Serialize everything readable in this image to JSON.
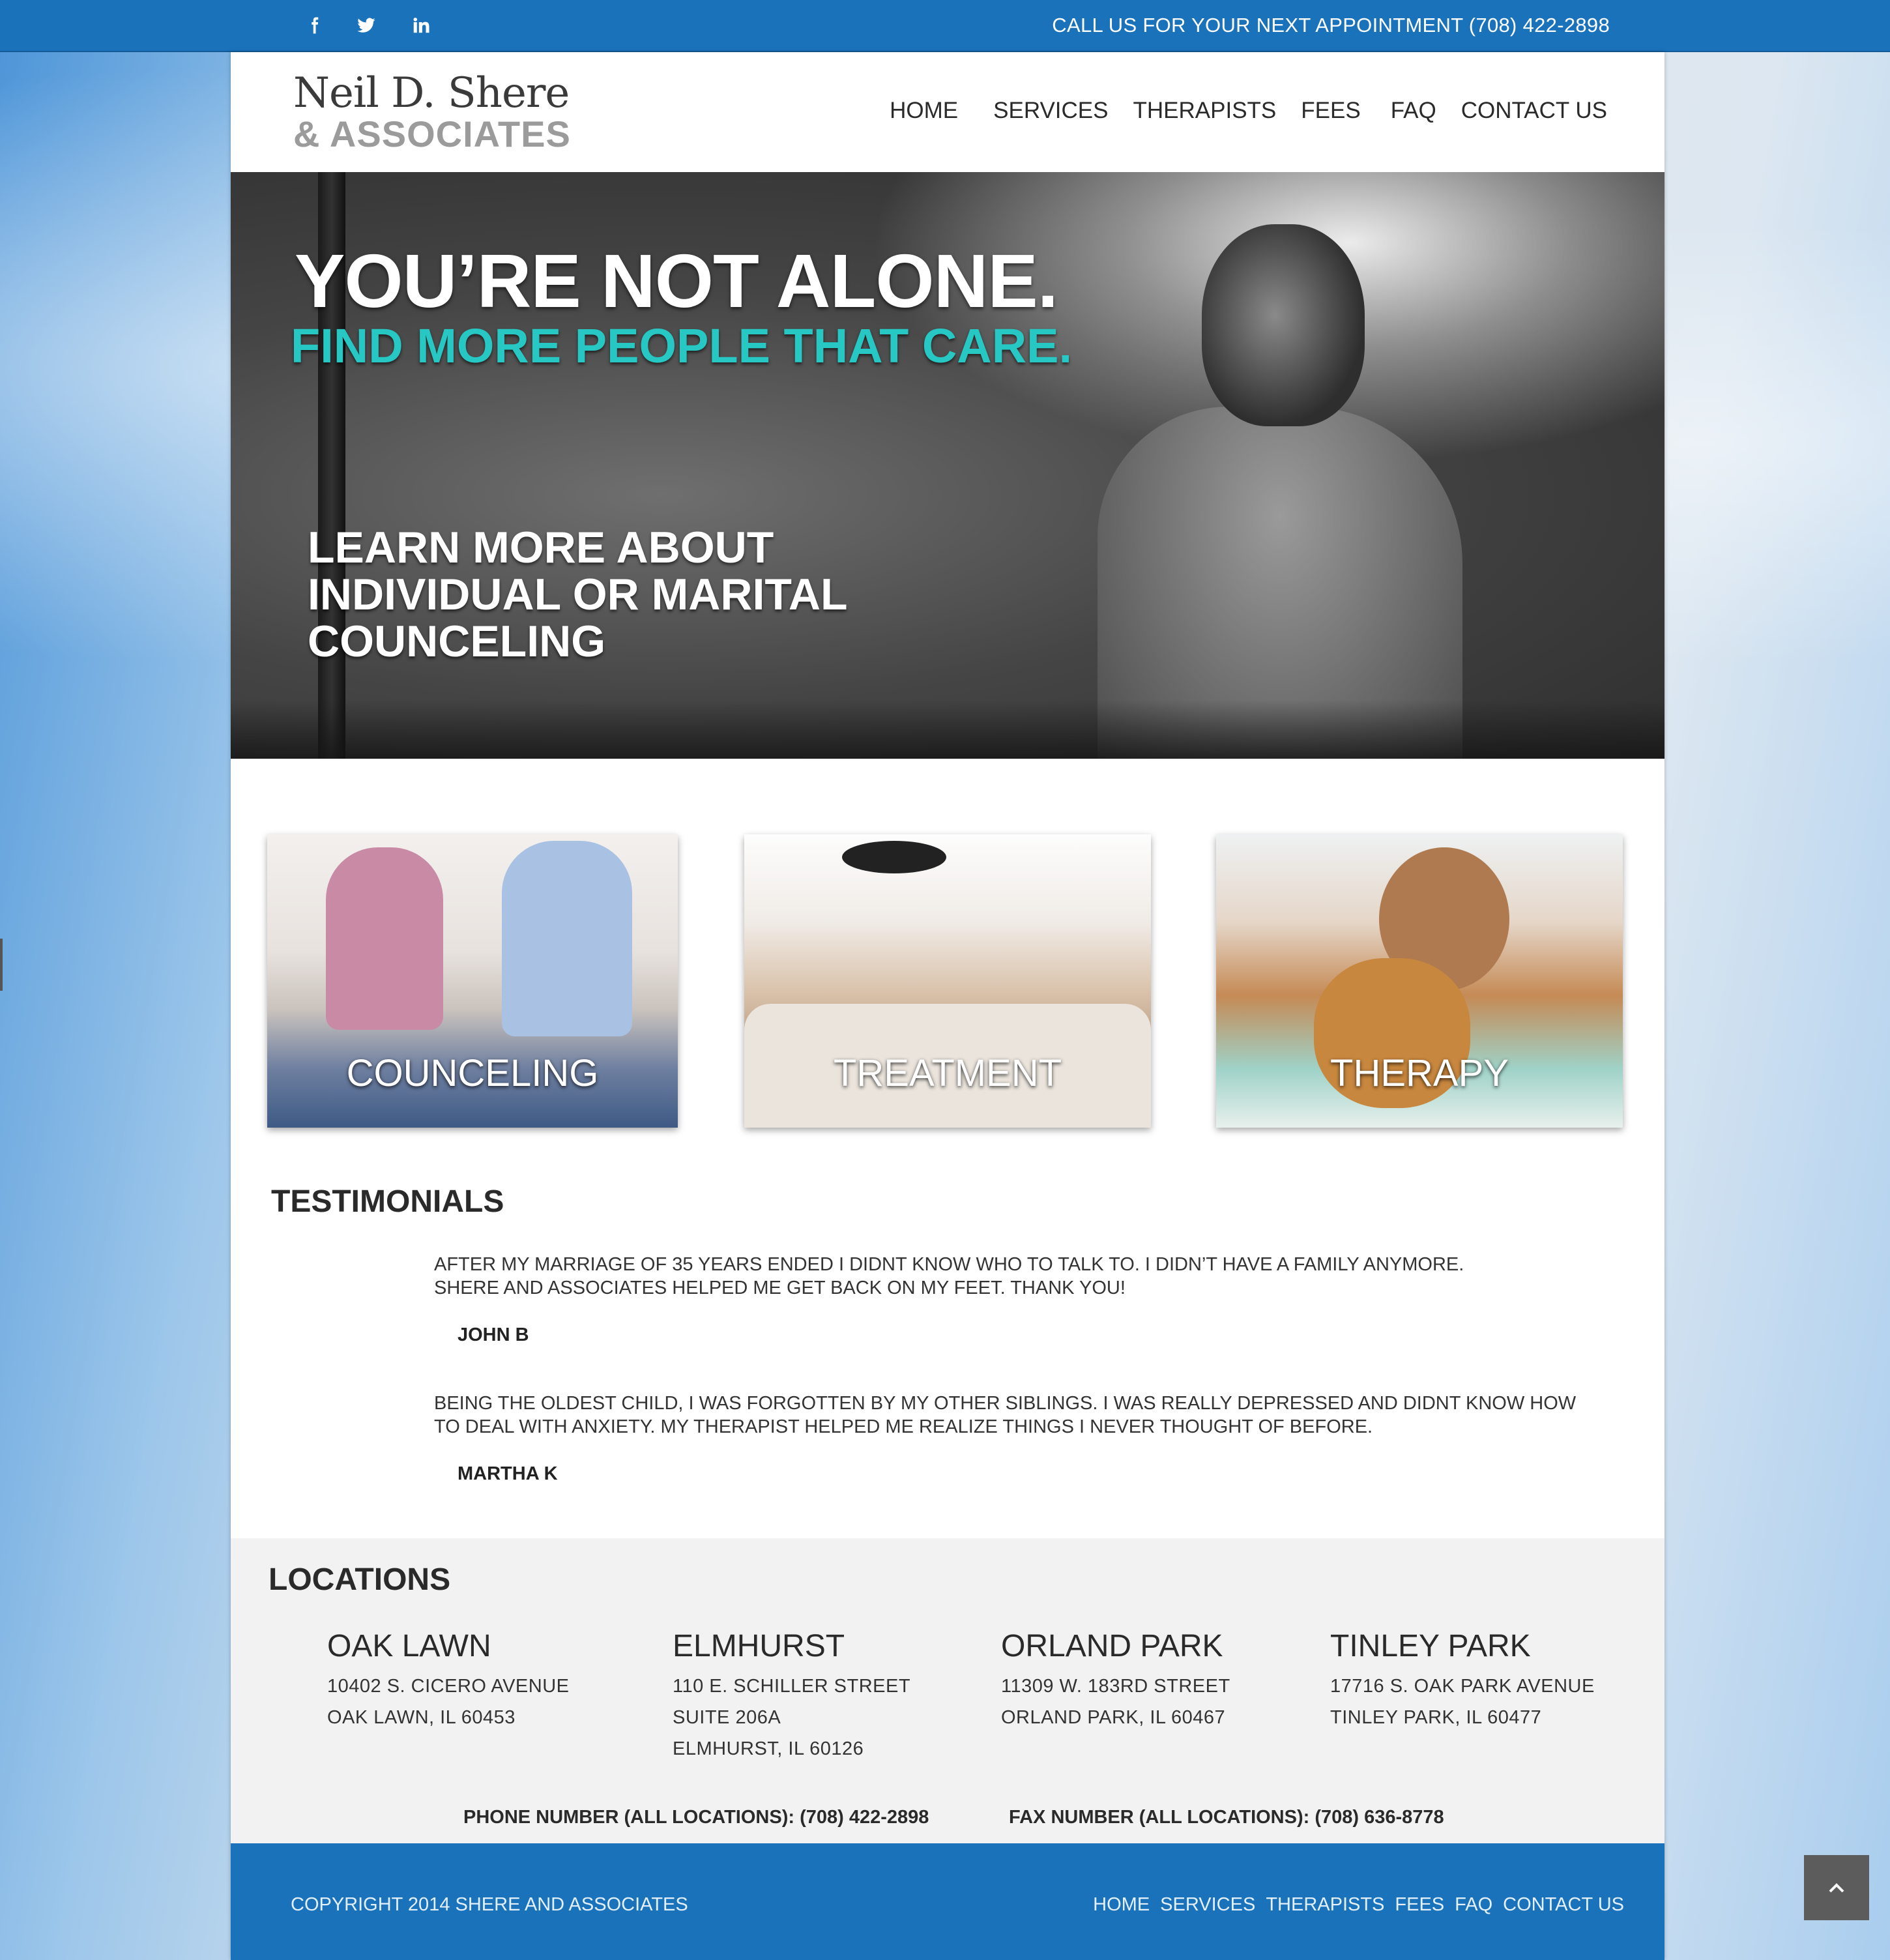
{
  "topbar": {
    "social": [
      {
        "name": "facebook-icon"
      },
      {
        "name": "twitter-icon"
      },
      {
        "name": "linkedin-icon"
      }
    ],
    "call_us": "CALL US FOR YOUR NEXT APPOINTMENT (708) 422-2898"
  },
  "logo": {
    "line1": "Neil D. Shere",
    "line2": "& ASSOCIATES"
  },
  "nav": [
    "HOME",
    "SERVICES",
    "THERAPISTS",
    "FEES",
    "FAQ",
    "CONTACT US"
  ],
  "hero": {
    "title": "YOU’RE NOT ALONE.",
    "subtitle": "FIND MORE PEOPLE THAT CARE.",
    "learn": [
      "LEARN MORE ABOUT",
      "INDIVIDUAL OR MARITAL",
      "COUNCELING"
    ]
  },
  "services": [
    "COUNCELING",
    "TREATMENT",
    "THERAPY"
  ],
  "testimonials": {
    "title": "TESTIMONIALS",
    "items": [
      {
        "quote": "AFTER MY MARRIAGE OF 35 YEARS ENDED I DIDNT KNOW WHO TO TALK TO. I DIDN’T HAVE A FAMILY ANYMORE.\nSHERE AND ASSOCIATES HELPED ME GET BACK ON MY FEET. THANK YOU!",
        "author": "JOHN B"
      },
      {
        "quote": "BEING THE OLDEST CHILD, I WAS FORGOTTEN BY MY OTHER SIBLINGS. I WAS REALLY DEPRESSED AND DIDNT KNOW HOW\nTO DEAL WITH ANXIETY.  MY THERAPIST HELPED ME REALIZE THINGS I NEVER THOUGHT OF BEFORE.",
        "author": "MARTHA K"
      }
    ]
  },
  "locations": {
    "title": "LOCATIONS",
    "items": [
      {
        "city": "OAK LAWN",
        "lines": [
          "10402 S. CICERO AVENUE",
          "OAK LAWN, IL 60453"
        ]
      },
      {
        "city": "ELMHURST",
        "lines": [
          "110 E. SCHILLER STREET",
          "SUITE 206A",
          "ELMHURST, IL 60126"
        ]
      },
      {
        "city": "ORLAND PARK",
        "lines": [
          "11309 W. 183RD STREET",
          "ORLAND PARK, IL 60467"
        ]
      },
      {
        "city": "TINLEY PARK",
        "lines": [
          "17716 S. OAK PARK AVENUE",
          "TINLEY PARK, IL 60477"
        ]
      }
    ],
    "phone": "PHONE NUMBER (ALL LOCATIONS): (708) 422-2898",
    "fax": "FAX NUMBER (ALL LOCATIONS): (708) 636-8778"
  },
  "footer": {
    "copyright": "COPYRIGHT 2014 SHERE AND ASSOCIATES",
    "nav": [
      "HOME",
      "SERVICES",
      "THERAPISTS",
      "FEES",
      "FAQ",
      "CONTACT US"
    ]
  },
  "back_to_top": {
    "icon": "chevron-up-icon"
  },
  "colors": {
    "brand_blue": "#1a72bb",
    "accent_teal": "#27c7c4",
    "footer_text": "#e3effa"
  }
}
